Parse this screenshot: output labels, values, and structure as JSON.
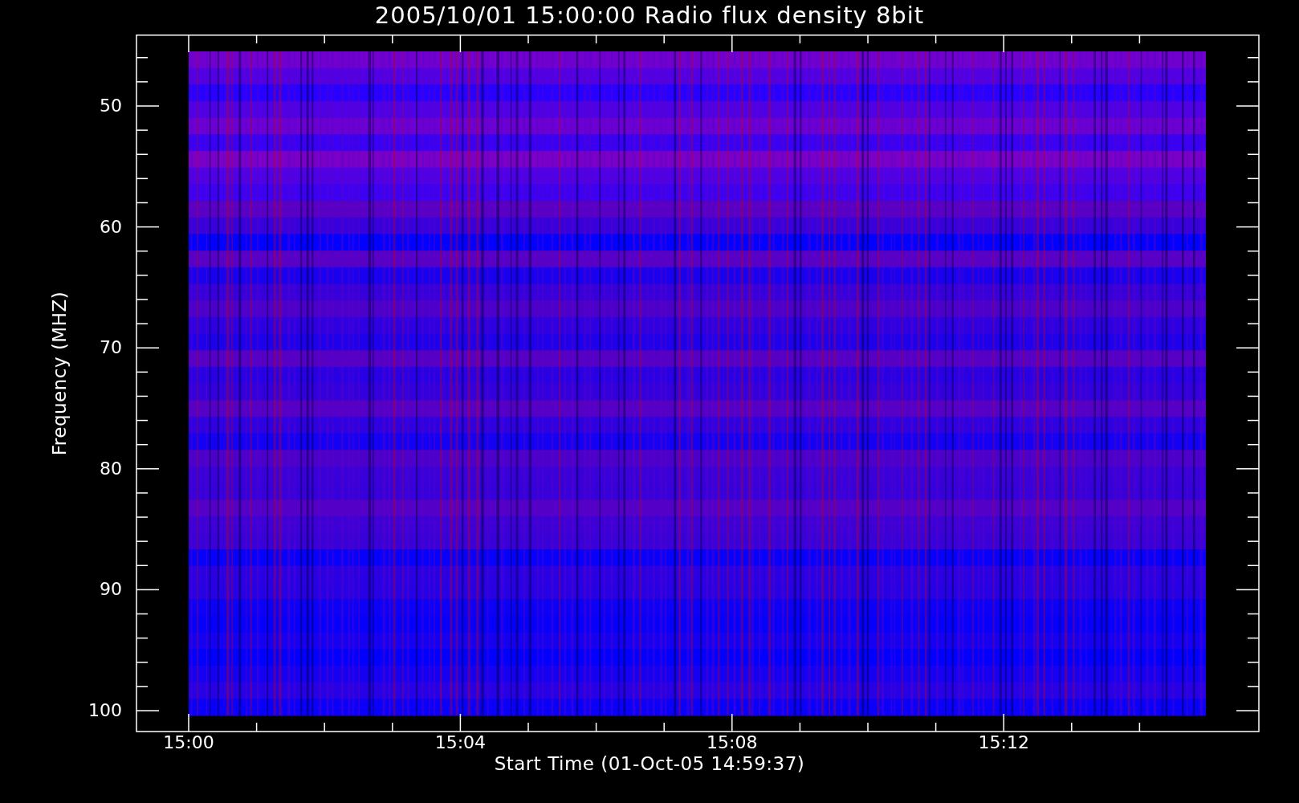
{
  "title": "2005/10/01 15:00:00 Radio flux density 8bit",
  "y_axis": {
    "label": "Frequency (MHZ)",
    "ticks": [
      "50",
      "60",
      "70",
      "80",
      "90",
      "100"
    ]
  },
  "x_axis": {
    "label": "Start Time (01-Oct-05 14:59:37)",
    "ticks": [
      "15:00",
      "15:04",
      "15:08",
      "15:12"
    ]
  }
}
